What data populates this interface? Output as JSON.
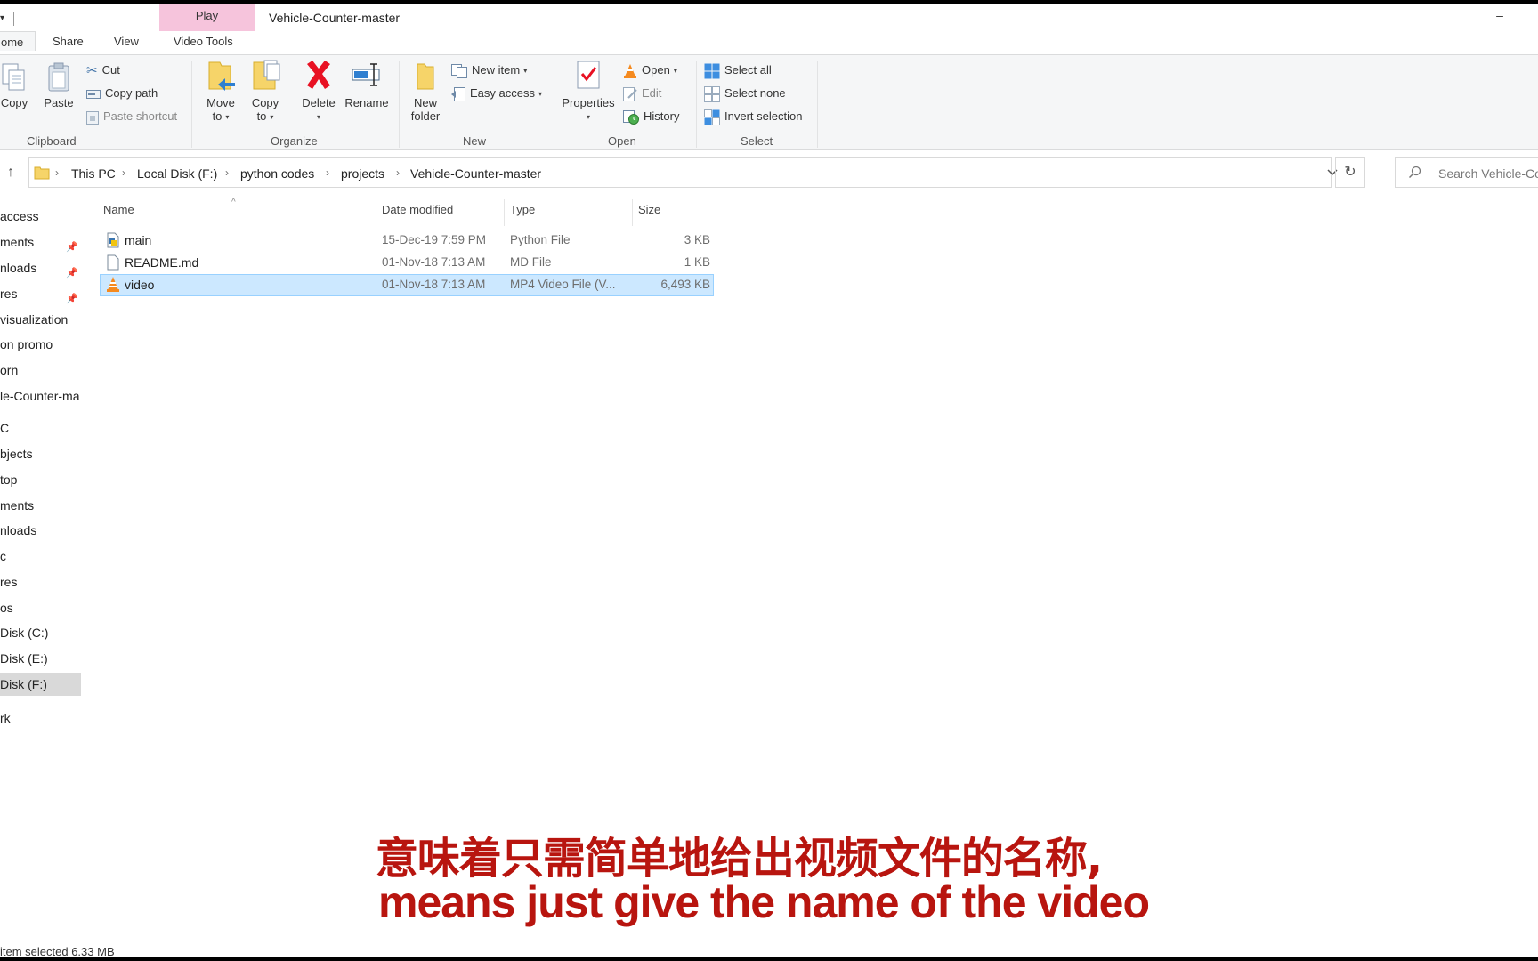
{
  "window": {
    "title": "Vehicle-Counter-master",
    "context_tab": "Play",
    "minimize_glyph": "–"
  },
  "tabs": {
    "home": "ome",
    "share": "Share",
    "view": "View",
    "video_tools": "Video Tools"
  },
  "ribbon": {
    "clipboard": {
      "label": "Clipboard",
      "copy": "Copy",
      "paste": "Paste",
      "cut": "Cut",
      "copy_path": "Copy path",
      "paste_shortcut": "Paste shortcut"
    },
    "organize": {
      "label": "Organize",
      "move_to_1": "Move",
      "move_to_2": "to",
      "copy_to_1": "Copy",
      "copy_to_2": "to",
      "delete": "Delete",
      "rename": "Rename"
    },
    "new": {
      "label": "New",
      "new_folder_1": "New",
      "new_folder_2": "folder",
      "new_item": "New item",
      "easy_access": "Easy access"
    },
    "open": {
      "label": "Open",
      "properties": "Properties",
      "open": "Open",
      "edit": "Edit",
      "history": "History"
    },
    "select": {
      "label": "Select",
      "select_all": "Select all",
      "select_none": "Select none",
      "invert_selection": "Invert selection"
    }
  },
  "address": {
    "crumbs": [
      "This PC",
      "Local Disk (F:)",
      "python codes",
      "projects",
      "Vehicle-Counter-master"
    ],
    "search_placeholder": "Search Vehicle-Co"
  },
  "nav": {
    "items": [
      "access",
      "ments",
      "nloads",
      "res",
      "visualization",
      "on promo",
      "orn",
      "le-Counter-ma",
      "C",
      "bjects",
      "top",
      "ments",
      "nloads",
      "c",
      "res",
      "os",
      "Disk (C:)",
      "Disk (E:)",
      "Disk (F:)",
      "rk"
    ]
  },
  "columns": {
    "name": "Name",
    "date": "Date modified",
    "type": "Type",
    "size": "Size"
  },
  "files": [
    {
      "name": "main",
      "date": "15-Dec-19 7:59 PM",
      "type": "Python File",
      "size": "3 KB"
    },
    {
      "name": "README.md",
      "date": "01-Nov-18 7:13 AM",
      "type": "MD File",
      "size": "1 KB"
    },
    {
      "name": "video",
      "date": "01-Nov-18 7:13 AM",
      "type": "MP4 Video File (V...",
      "size": "6,493 KB"
    }
  ],
  "status": {
    "text": "item selected  6.33 MB"
  },
  "subtitles": {
    "chinese": "意味着只需简单地给出视频文件的名称,",
    "english": "means just give the name of the video"
  },
  "colors": {
    "selection_bg": "#cce8ff",
    "context_tab": "#f6c4dc",
    "subtitle_red": "#b8150f",
    "delete_red": "#e81123"
  }
}
